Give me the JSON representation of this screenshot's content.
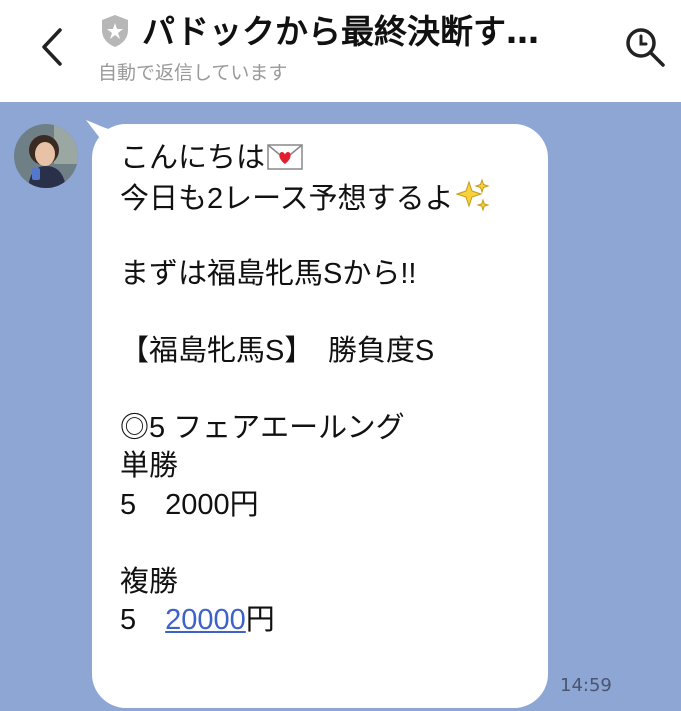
{
  "header": {
    "title": "パドックから最終決断す…",
    "subtitle": "自動で返信しています"
  },
  "message": {
    "lines": {
      "l1": "こんにちは",
      "l2": "今日も2レース予想するよ",
      "l3": "まずは福島牝馬Sから!!",
      "l4": "【福島牝馬S】　勝負度S",
      "l5": "◎5 フェアエールング",
      "l6": "単勝",
      "l7": "5　2000円",
      "l8": "複勝",
      "l9_num": "5　",
      "l9_link": "20000",
      "l9_unit": "円"
    },
    "time": "14:59"
  },
  "colors": {
    "chat_background": "#8ea6d4",
    "bubble": "#ffffff",
    "link": "#3d62c9"
  },
  "icons": {
    "back": "chevron-left-icon",
    "shield": "shield-icon",
    "search": "search-icon",
    "letter": "love-letter-icon",
    "sparkles": "sparkles-icon"
  }
}
